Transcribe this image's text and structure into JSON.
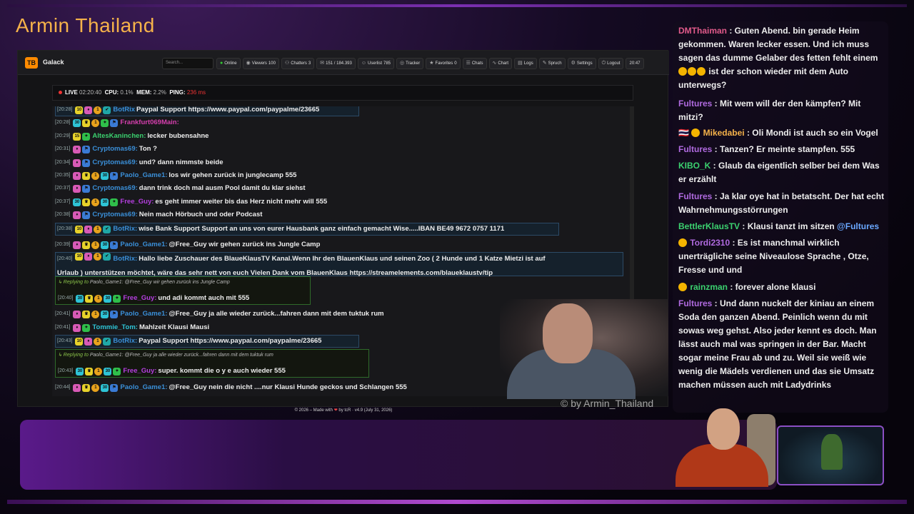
{
  "stream_title": "Armin Thailand",
  "app": {
    "logo": "TB",
    "name": "Galack",
    "search_placeholder": "Search...",
    "nav": [
      {
        "icon": "online-icon",
        "label": "Online"
      },
      {
        "icon": "eye-icon",
        "label": "Viewers",
        "count": "100"
      },
      {
        "icon": "users-icon",
        "label": "Chatters",
        "count": "3"
      },
      {
        "icon": "chat-icon",
        "label": "151 / 184.393"
      },
      {
        "icon": "user-icon",
        "label": "Userlist",
        "count": "785"
      },
      {
        "icon": "tracker-icon",
        "label": "Tracker"
      },
      {
        "icon": "star-icon",
        "label": "Favorites",
        "count": "0"
      },
      {
        "icon": "chats-icon",
        "label": "Chats"
      },
      {
        "icon": "chart-icon",
        "label": "Chart"
      },
      {
        "icon": "logs-icon",
        "label": "Logs"
      },
      {
        "icon": "spruch-icon",
        "label": "Spruch"
      },
      {
        "icon": "gear-icon",
        "label": "Settings"
      },
      {
        "icon": "logout-icon",
        "label": "Logout"
      },
      {
        "icon": "",
        "label": "20:47"
      }
    ]
  },
  "status": {
    "live": "LIVE",
    "uptime": "02:20:40",
    "cpu_label": "CPU:",
    "cpu": "0.1%",
    "mem_label": "MEM:",
    "mem": "2.2%",
    "ping_label": "PING:",
    "ping": "236 ms"
  },
  "messages": [
    {
      "ts": "[20:28]",
      "badges": [
        "yel10",
        "pink",
        "org",
        "teal"
      ],
      "nick": "BotRix",
      "nick_color": "#3a8fd8",
      "text": "Paypal Support https://www.paypal.com/paypalme/23665",
      "style": "box"
    },
    {
      "ts": "[20:28]",
      "badges": [
        "cyan",
        "yel",
        "org",
        "grn",
        "blue"
      ],
      "nick": "Frankfurt069Main:",
      "nick_color": "#d63fae",
      "text": "",
      "style": ""
    },
    {
      "ts": "[20:29]",
      "badges": [
        "yel15",
        "grn"
      ],
      "nick": "AltesKaninchen:",
      "nick_color": "#3bd16f",
      "text": "lecker bubensahne",
      "style": ""
    },
    {
      "ts": "[20:31]",
      "badges": [
        "pink",
        "blue"
      ],
      "nick": "Cryptomas69:",
      "nick_color": "#3a8fd8",
      "text": "Ton ?",
      "style": ""
    },
    {
      "ts": "[20:34]",
      "badges": [
        "pink",
        "blue"
      ],
      "nick": "Cryptomas69:",
      "nick_color": "#3a8fd8",
      "text": "und? dann nimmste beide",
      "style": ""
    },
    {
      "ts": "[20:35]",
      "badges": [
        "pink",
        "yel",
        "org",
        "cyan",
        "blue"
      ],
      "nick": "Paolo_Game1:",
      "nick_color": "#3a8fd8",
      "text": "los wir gehen zurück in junglecamp 555",
      "style": ""
    },
    {
      "ts": "[20:37]",
      "badges": [
        "pink",
        "blue"
      ],
      "nick": "Cryptomas69:",
      "nick_color": "#3a8fd8",
      "text": "dann trink doch mal ausm Pool damit du klar siehst",
      "style": ""
    },
    {
      "ts": "[20:37]",
      "badges": [
        "cyan",
        "yel",
        "org",
        "cyan",
        "grn"
      ],
      "nick": "Free_Guy:",
      "nick_color": "#b53fe0",
      "text": "es geht immer weiter bis das Herz nicht mehr will 555",
      "style": ""
    },
    {
      "ts": "[20:38]",
      "badges": [
        "pink",
        "blue"
      ],
      "nick": "Cryptomas69:",
      "nick_color": "#3a8fd8",
      "text": "Nein mach Hörbuch und oder Podcast",
      "style": ""
    },
    {
      "ts": "[20:38]",
      "badges": [
        "yel10",
        "pink",
        "org",
        "teal"
      ],
      "nick": "BotRix:",
      "nick_color": "#3a8fd8",
      "text": "wise Bank Support Support an uns von eurer Hausbank ganz einfach gemacht Wise.....IBAN BE49 9672 0757 1171",
      "style": "box"
    },
    {
      "ts": "[20:39]",
      "badges": [
        "pink",
        "yel",
        "org",
        "cyan",
        "blue"
      ],
      "nick": "Paolo_Game1:",
      "nick_color": "#3a8fd8",
      "text": "@Free_Guy wir gehen zurück ins Jungle Camp",
      "style": ""
    },
    {
      "ts": "[20:40]",
      "badges": [
        "yel10",
        "pink",
        "org",
        "teal"
      ],
      "nick": "BotRix:",
      "nick_color": "#3a8fd8",
      "text": "Hallo liebe Zuschauer des BlaueKlausTV Kanal.Wenn Ihr den BlauenKlaus und seinen Zoo ( 2 Hunde und 1 Katze Mietzi ist auf",
      "text2": "Urlaub ) unterstützen möchtet, wäre das sehr nett von euch Vielen Dank vom BlauenKlaus https://streamelements.com/blaueklaustv/tip",
      "style": "box2"
    },
    {
      "reply_label": "Replying to",
      "reply_to": "Paolo_Game1:",
      "reply_text": "@Free_Guy wir gehen zurück ins Jungle Camp",
      "ts": "[20:40]",
      "badges": [
        "cyan",
        "yel",
        "org",
        "cyan",
        "grn"
      ],
      "nick": "Free_Guy:",
      "nick_color": "#b53fe0",
      "text": "und adi kommt auch mit 555",
      "style": "reply"
    },
    {
      "ts": "[20:41]",
      "badges": [
        "pink",
        "yel",
        "org",
        "cyan",
        "blue"
      ],
      "nick": "Paolo_Game1:",
      "nick_color": "#3a8fd8",
      "text": "@Free_Guy ja alle wieder zurück...fahren dann mit dem tuktuk rum",
      "style": ""
    },
    {
      "ts": "[20:41]",
      "badges": [
        "pink",
        "grn"
      ],
      "nick": "Tommie_Tom:",
      "nick_color": "#2ec4d6",
      "text": "Mahlzeit Klausi Mausi",
      "style": ""
    },
    {
      "ts": "[20:43]",
      "badges": [
        "yel10",
        "pink",
        "org",
        "teal"
      ],
      "nick": "BotRix:",
      "nick_color": "#3a8fd8",
      "text": "Paypal Support https://www.paypal.com/paypalme/23665",
      "style": "box"
    },
    {
      "reply_label": "Replying to",
      "reply_to": "Paolo_Game1:",
      "reply_text": "@Free_Guy ja alle wieder zurück...fahren dann mit dem tuktuk rum",
      "ts": "[20:43]",
      "badges": [
        "cyan",
        "yel",
        "org",
        "cyan",
        "grn"
      ],
      "nick": "Free_Guy:",
      "nick_color": "#b53fe0",
      "text": "super. kommt die o y e auch wieder 555",
      "style": "reply"
    },
    {
      "ts": "[20:44]",
      "badges": [
        "pink",
        "yel",
        "org",
        "cyan",
        "blue"
      ],
      "nick": "Paolo_Game1:",
      "nick_color": "#3a8fd8",
      "text": "@Free_Guy nein die nicht ....nur Klausi Hunde geckos und Schlangen 555",
      "style": ""
    }
  ],
  "watermark": "© by Armin_Thailand",
  "footer": {
    "pre": "© 2026 – Made with",
    "post": "by tcR · v4.9 (July 31, 2026)"
  },
  "side_chat": [
    {
      "nick": "DMThaiman",
      "color": "#e05a8a",
      "text": ": Guten Abend. bin gerade Heim gekommen. Waren lecker essen. Und ich muss sagen das dumme Gelaber des fetten fehlt einem",
      "tail": "ist der schon wieder mit dem Auto unterwegs?"
    },
    {
      "nick": "Fultures",
      "color": "#b06ae0",
      "text": ": Mit wem will der den kämpfen? Mit mitzi?"
    },
    {
      "nick": "Mikedabei",
      "color": "#f5b24a",
      "text": ": Oli Mondi ist auch so ein Vogel"
    },
    {
      "nick": "Fultures",
      "color": "#b06ae0",
      "text": ": Tanzen? Er meinte stampfen. 555"
    },
    {
      "nick": "KIBO_K",
      "color": "#3bd16f",
      "text": ": Glaub da eigentlich selber bei dem Was er erzählt"
    },
    {
      "nick": "Fultures",
      "color": "#b06ae0",
      "text": ": Ja klar oye hat in betatscht. Der hat echt Wahrnehmungsstörrungen"
    },
    {
      "nick": "BettlerKlausTV",
      "color": "#3bd16f",
      "text": ": Klausi tanzt im sitzen",
      "mention": "@Fultures"
    },
    {
      "nick": "Tordi2310",
      "color": "#b06ae0",
      "text": ": Es ist manchmal wirklich unerträgliche seine Niveaulose Sprache , Otze, Fresse und und"
    },
    {
      "nick": "rainzman",
      "color": "#3bd16f",
      "text": ": forever alone klausi"
    },
    {
      "nick": "Fultures",
      "color": "#b06ae0",
      "text": ": Und dann nuckelt der kiniau an einem Soda den ganzen Abend. Peinlich wenn du mit sowas weg gehst. Also jeder kennt es doch. Man lässt auch mal was springen in der Bar. Macht sogar meine Frau ab und zu. Weil sie weiß wie wenig die Mädels verdienen und das sie Umsatz machen müssen auch mit Ladydrinks"
    }
  ]
}
